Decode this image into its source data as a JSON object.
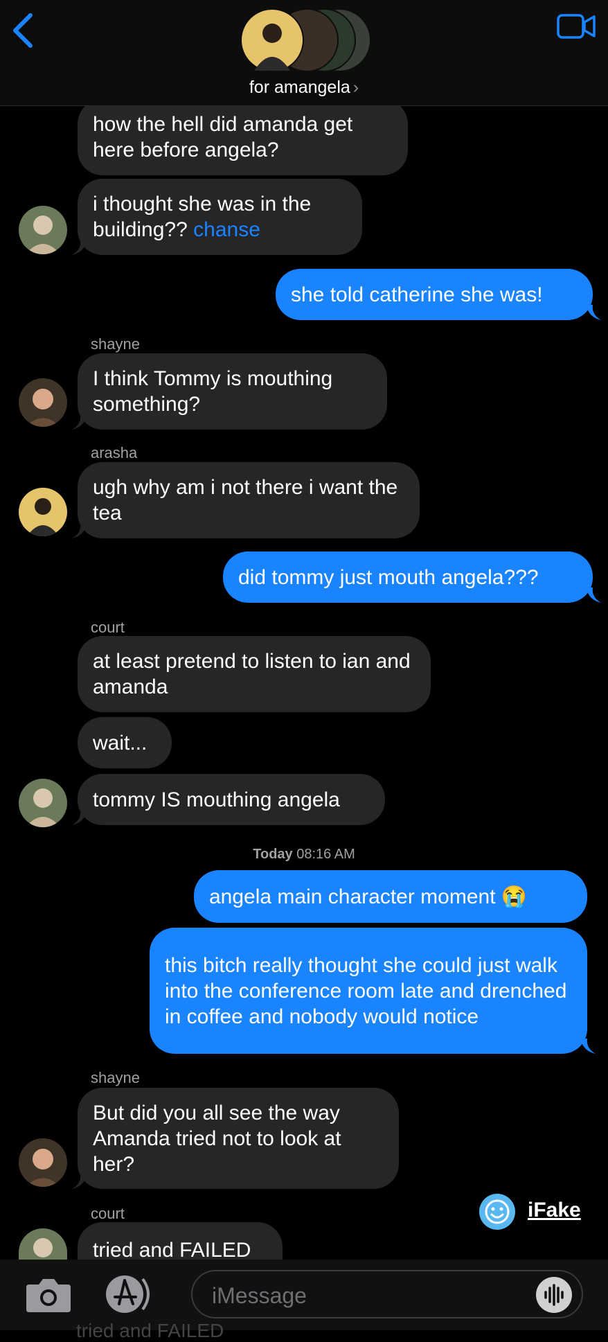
{
  "header": {
    "group_name": "for amangela",
    "back_icon": "chevron-left-icon",
    "video_icon": "video-camera-icon"
  },
  "messages": [
    {
      "text": "how the hell did amanda get here before angela?"
    },
    {
      "text": "i thought she was in the building??",
      "mention": "chanse"
    },
    {
      "text": "she told catherine she was!"
    },
    {
      "sender": "shayne",
      "text": "I think Tommy is mouthing something?"
    },
    {
      "sender": "arasha",
      "text": "ugh why am i not there i want the tea"
    },
    {
      "text": "did tommy just mouth angela???"
    },
    {
      "sender": "court",
      "text": "at least pretend to listen to ian and amanda"
    },
    {
      "text": "wait..."
    },
    {
      "text": "tommy IS mouthing angela"
    },
    {
      "timestamp_day": "Today",
      "timestamp_time": "08:16 AM"
    },
    {
      "text": "angela main character moment 😭"
    },
    {
      "text": "this bitch really thought she could just walk into the conference room late and drenched in coffee and nobody would notice"
    },
    {
      "sender": "shayne",
      "text": "But did you all see the way Amanda tried not to look at her?"
    },
    {
      "sender": "court",
      "text": "tried and FAILED"
    }
  ],
  "watermark": {
    "label": "iFake"
  },
  "composer": {
    "placeholder": "iMessage",
    "camera_icon": "camera-icon",
    "apps_icon": "app-store-icon",
    "audio_icon": "audio-waveform-icon"
  },
  "underlay_text": "tried and FAILED",
  "colors": {
    "outgoing": "#1a84ff",
    "incoming": "#262628",
    "link": "#1a84ff",
    "background": "#000000"
  }
}
